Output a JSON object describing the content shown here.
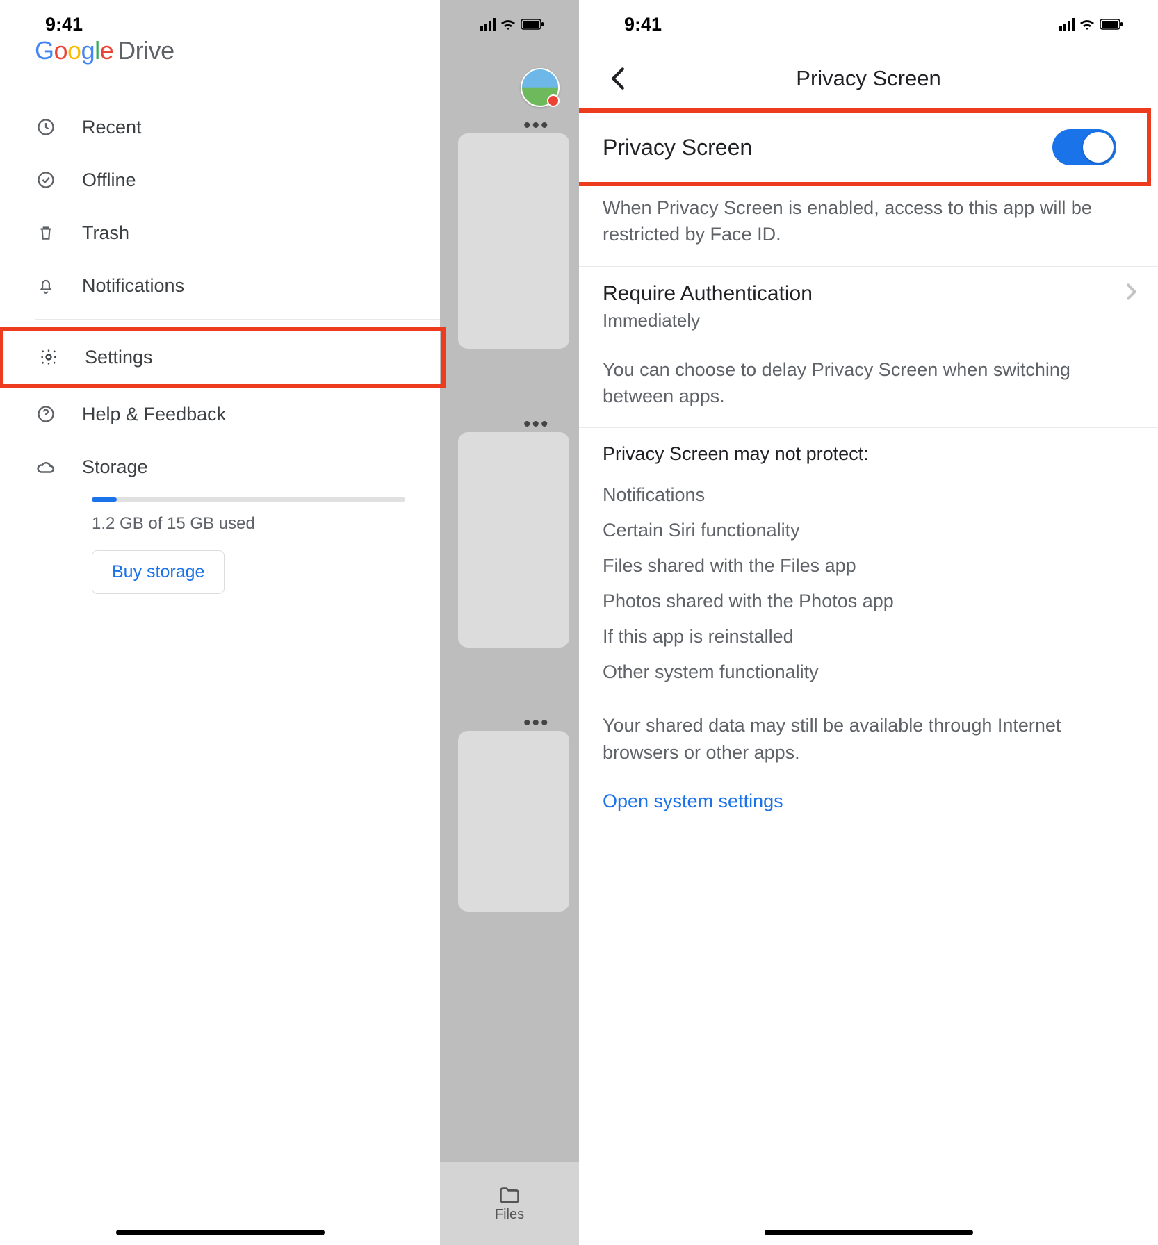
{
  "status": {
    "time": "9:41"
  },
  "left": {
    "logo_drive": "Drive",
    "nav": {
      "recent": "Recent",
      "offline": "Offline",
      "trash": "Trash",
      "notifications": "Notifications",
      "settings": "Settings",
      "help": "Help & Feedback",
      "storage": "Storage"
    },
    "storage": {
      "used_text": "1.2 GB of 15 GB used",
      "buy_label": "Buy storage"
    },
    "tabs": {
      "files": "Files"
    }
  },
  "right": {
    "title": "Privacy Screen",
    "toggle": {
      "label": "Privacy Screen",
      "on": true
    },
    "desc1": "When Privacy Screen is enabled, access to this app will be restricted by Face ID.",
    "auth": {
      "title": "Require Authentication",
      "value": "Immediately"
    },
    "desc2": "You can choose to delay Privacy Screen when switching between apps.",
    "may_not_head": "Privacy Screen may not protect:",
    "may_not": [
      "Notifications",
      "Certain Siri functionality",
      "Files shared with the Files app",
      "Photos shared with the Photos app",
      "If this app is reinstalled",
      "Other system functionality"
    ],
    "shared_note": "Your shared data may still be available through Internet browsers or other apps.",
    "open_settings": "Open system settings"
  }
}
